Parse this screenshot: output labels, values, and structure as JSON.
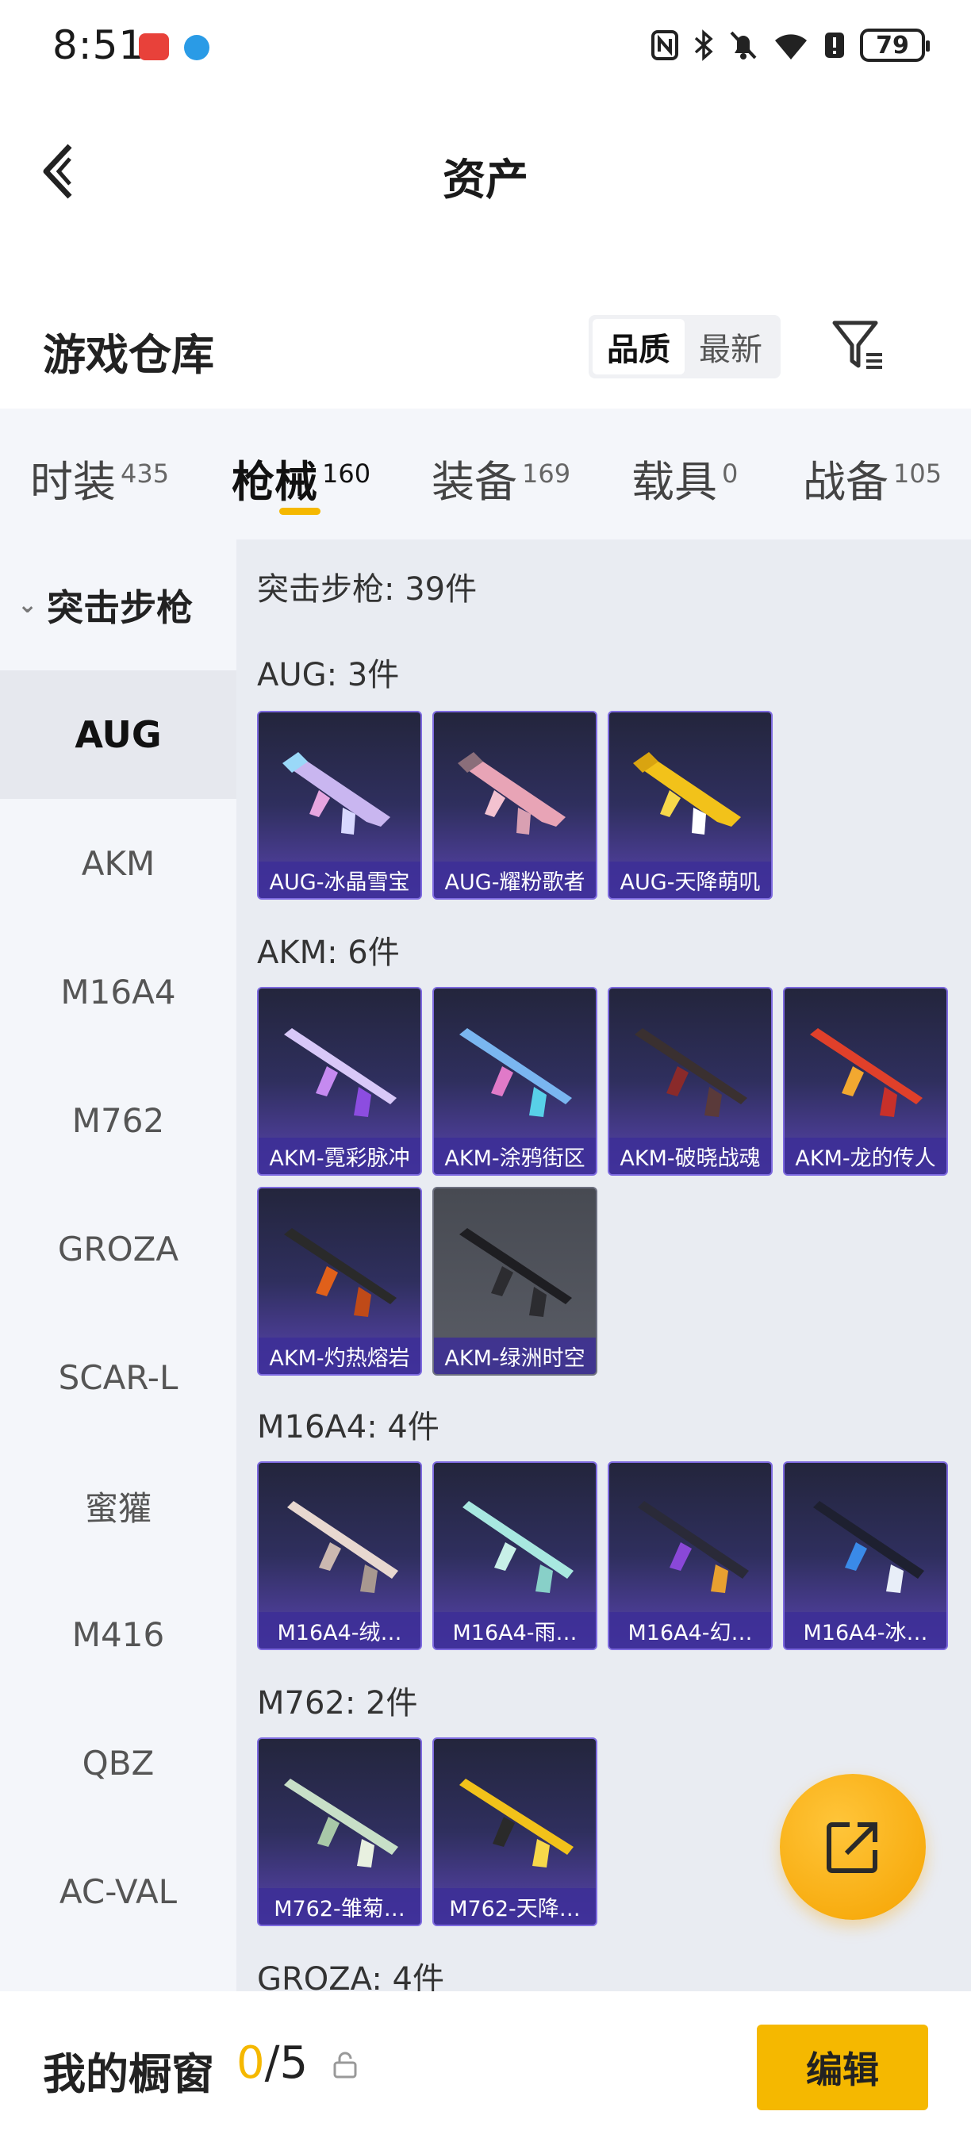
{
  "status": {
    "time": "8:51",
    "battery": "79",
    "icons": [
      "nfc-icon",
      "bluetooth-icon",
      "mute-icon",
      "wifi-icon",
      "alert-icon",
      "battery-icon"
    ]
  },
  "header": {
    "title": "资产"
  },
  "warehouse": {
    "title": "游戏仓库",
    "sort_options": [
      "品质",
      "最新"
    ],
    "sort_active": "品质"
  },
  "tabs": [
    {
      "label": "时装",
      "count": "435"
    },
    {
      "label": "枪械",
      "count": "160",
      "active": true
    },
    {
      "label": "装备",
      "count": "169"
    },
    {
      "label": "载具",
      "count": "0"
    },
    {
      "label": "战备",
      "count": "105"
    }
  ],
  "sidebar": {
    "group": "突击步枪",
    "items": [
      "AUG",
      "AKM",
      "M16A4",
      "M762",
      "GROZA",
      "SCAR-L",
      "蜜獾",
      "M416",
      "QBZ",
      "AC-VAL"
    ],
    "active": "AUG"
  },
  "content": {
    "summary": "突击步枪: 39件",
    "sections": [
      {
        "heading": "AUG: 3件",
        "items": [
          "AUG-冰晶雪宝",
          "AUG-耀粉歌者",
          "AUG-天降萌叽"
        ]
      },
      {
        "heading": "AKM: 6件",
        "items": [
          "AKM-霓彩脉冲",
          "AKM-涂鸦街区",
          "AKM-破晓战魂",
          "AKM-龙的传人",
          "AKM-灼热熔岩",
          "AKM-绿洲时空"
        ]
      },
      {
        "heading": "M16A4: 4件",
        "items": [
          "M16A4-绒…",
          "M16A4-雨…",
          "M16A4-幻…",
          "M16A4-冰…"
        ]
      },
      {
        "heading": "M762: 2件",
        "items": [
          "M762-雏菊…",
          "M762-天降…"
        ]
      },
      {
        "heading": "GROZA: 4件",
        "items": []
      }
    ]
  },
  "bottom": {
    "title": "我的橱窗",
    "count_current": "0",
    "count_total": "/5",
    "edit_label": "编辑"
  },
  "colors": {
    "accent": "#f5b800",
    "card_purple": "#5944b0"
  }
}
